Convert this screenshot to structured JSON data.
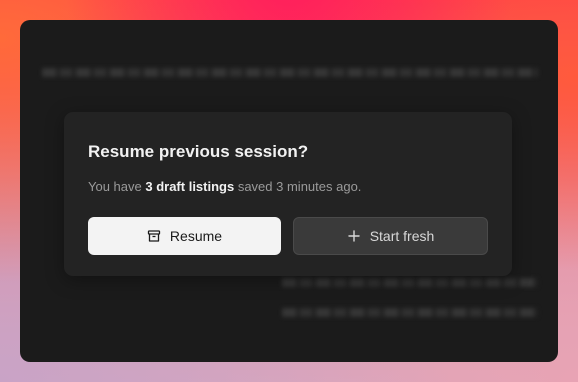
{
  "dialog": {
    "title": "Resume previous session?",
    "message_prefix": "You have ",
    "message_highlight": "3 draft listings",
    "message_suffix": " saved 3 minutes ago.",
    "resume_label": "Resume",
    "start_fresh_label": "Start fresh",
    "resume_icon": "archive-icon",
    "start_fresh_icon": "plus-icon"
  },
  "colors": {
    "window_bg": "#1b1b1b",
    "dialog_bg": "#232323",
    "primary_button_bg": "#f3f3f3",
    "secondary_button_bg": "#3a3a3a"
  }
}
